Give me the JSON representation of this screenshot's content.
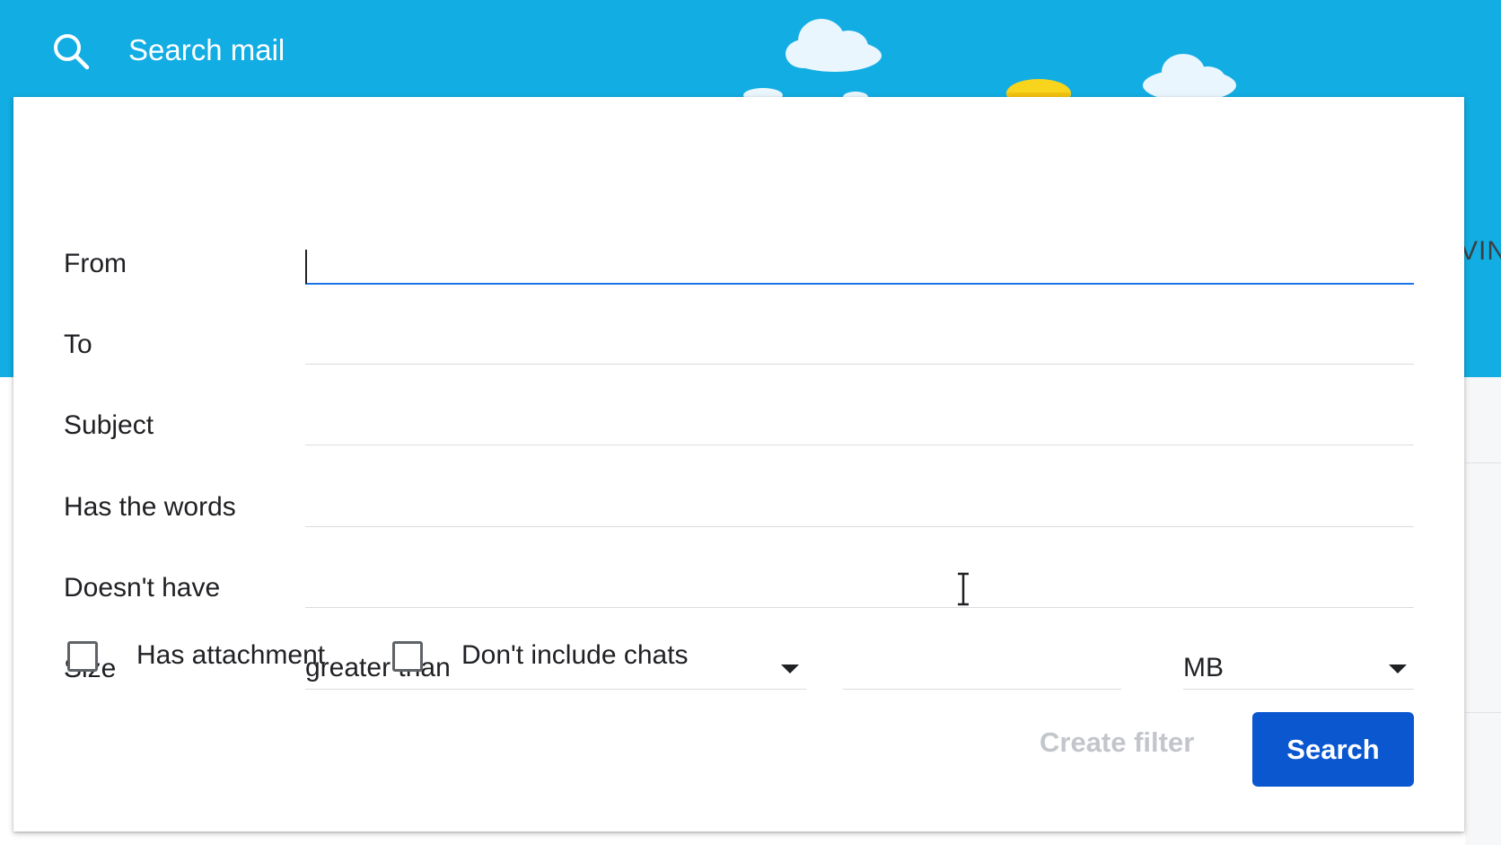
{
  "search_bar": {
    "placeholder": "Search mail",
    "icon": "search-icon"
  },
  "background_text": "VIN",
  "form": {
    "fields": [
      {
        "label": "From",
        "value": ""
      },
      {
        "label": "To",
        "value": ""
      },
      {
        "label": "Subject",
        "value": ""
      },
      {
        "label": "Has the words",
        "value": ""
      },
      {
        "label": "Doesn't have",
        "value": ""
      }
    ],
    "size": {
      "label": "Size",
      "operator": "greater than",
      "value": "",
      "unit": "MB"
    },
    "checkboxes": [
      {
        "label": "Has attachment",
        "checked": false
      },
      {
        "label": "Don't include chats",
        "checked": false
      }
    ],
    "create_filter_label": "Create filter",
    "search_label": "Search"
  },
  "colors": {
    "header_blue": "#12ade3",
    "accent_blue": "#1a73e8",
    "search_button": "#0b57d0",
    "disabled_text": "#c2c5ca"
  }
}
